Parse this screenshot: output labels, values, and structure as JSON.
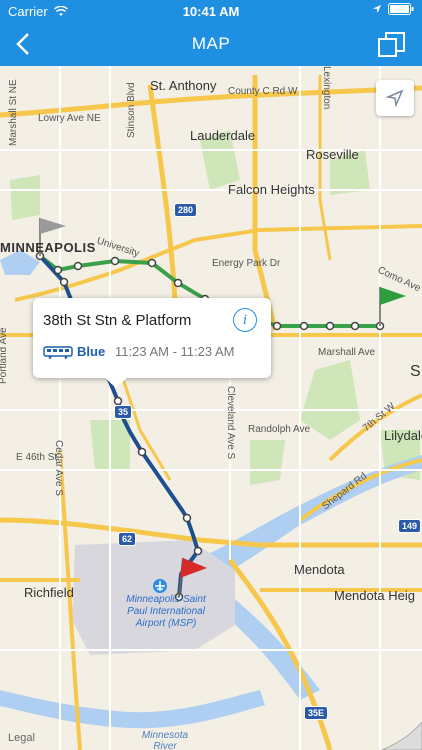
{
  "status": {
    "carrier": "Carrier",
    "time": "10:41 AM"
  },
  "nav": {
    "title": "MAP"
  },
  "callout": {
    "stop_name": "38th St Stn & Platform",
    "route": "Blue",
    "times": "11:23 AM - 11:23 AM"
  },
  "map": {
    "labels": {
      "st_anthony": "St. Anthony",
      "county_c_rd": "County C Rd W",
      "lowry": "Lowry Ave NE",
      "lauderdale": "Lauderdale",
      "roseville": "Roseville",
      "falcon_heights": "Falcon Heights",
      "minneapolis": "MINNEAPOLIS",
      "university": "University",
      "energy_park": "Energy Park Dr",
      "como": "Como Ave",
      "marshall": "Marshall Ave",
      "portland": "Portland Ave",
      "cedar": "Cedar Ave S",
      "cleveland": "Cleveland Ave S",
      "randolph": "Randolph Ave",
      "e46th": "E 46th St",
      "seventh": "7th St W",
      "shepard": "Shepard Rd",
      "lilydale": "Lilydale",
      "mendota": "Mendota",
      "mendota_heights": "Mendota Heig",
      "richfield": "Richfield",
      "airport": "Minneapolis-Saint Paul International Airport (MSP)",
      "minnesota_river": "Minnesota River",
      "stinson": "Stinson Blvd",
      "marshall_st": "Marshall St NE",
      "lexington": "Lexington",
      "s_label": "S"
    },
    "shields": {
      "i280": "280",
      "i35w": "35",
      "r62": "62",
      "i149": "149",
      "i35e": "35E"
    },
    "legal": "Legal"
  },
  "colors": {
    "accent": "#1f8fe2",
    "blue_line": "#1d4f8f",
    "green_line": "#3aa14a"
  }
}
